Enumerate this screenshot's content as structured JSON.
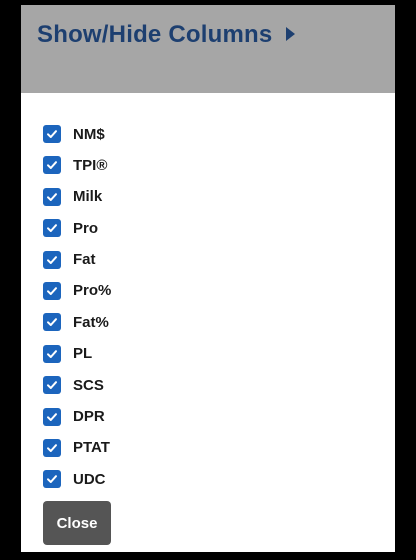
{
  "header": {
    "title": "Show/Hide Columns",
    "arrow_icon": "caret-right-icon"
  },
  "columns": [
    {
      "label": "NM$",
      "checked": true
    },
    {
      "label": "TPI®",
      "checked": true
    },
    {
      "label": "Milk",
      "checked": true
    },
    {
      "label": "Pro",
      "checked": true
    },
    {
      "label": "Fat",
      "checked": true
    },
    {
      "label": "Pro%",
      "checked": true
    },
    {
      "label": "Fat%",
      "checked": true
    },
    {
      "label": "PL",
      "checked": true
    },
    {
      "label": "SCS",
      "checked": true
    },
    {
      "label": "DPR",
      "checked": true
    },
    {
      "label": "PTAT",
      "checked": true
    },
    {
      "label": "UDC",
      "checked": true
    }
  ],
  "close_label": "Close",
  "colors": {
    "header_bg": "#a6a6a6",
    "title": "#1d3f70",
    "checkbox": "#1c65bd",
    "button": "#555555"
  }
}
